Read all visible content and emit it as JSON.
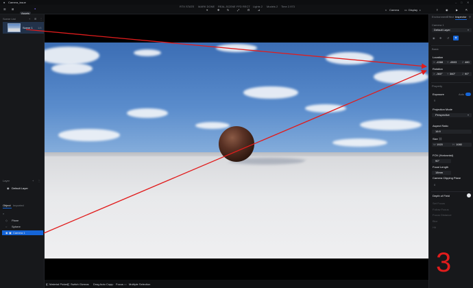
{
  "window": {
    "title": "Camera_issue"
  },
  "toolbar": {
    "assets_label": "Assets",
    "menu_items": [
      "RTX STATE",
      "MARK DONE",
      "REAL-SCENE",
      "FFD RECT",
      "Lights 2",
      "Models 2",
      "Time 2.973"
    ],
    "camera_label": "Camera",
    "display_label": "Display"
  },
  "left": {
    "scene_list_label": "Scene List",
    "scene_name": "Scene 1",
    "scene_count": "1/4",
    "layer_label": "Layer",
    "default_layer": "Default Layer",
    "object_tab": "Object",
    "imported_tab": "Imported",
    "objects": [
      "Plane",
      "Sphere",
      "Camera 1"
    ]
  },
  "right": {
    "tabs": [
      "Environment",
      "Effect",
      "Inspector"
    ],
    "camera_label": "Camera 1",
    "layer_value": "Default Layer",
    "basic_label": "Basic",
    "location_label": "Location",
    "location": {
      "x": "-4388",
      "y": "-6503",
      "z": "480"
    },
    "rotation_label": "Rotation",
    "rotation": {
      "x": "-360°",
      "y": "360°",
      "z": "90°"
    },
    "property_label": "Property",
    "exposure_label": "Exposure",
    "exposure_auto": "Auto",
    "exposure_value": "0",
    "projection_label": "Projection Mode",
    "projection_value": "Perspective",
    "aspect_label": "Aspect Ratio",
    "aspect_value": "16:9",
    "size_label": "Size",
    "size_w": "1920",
    "size_h": "1080",
    "fov_label": "FOV (Horizontal)",
    "fov_value": "90°",
    "focal_label": "Focal Length",
    "focal_value": "18mm",
    "clip_label": "Camera Clipping Plane",
    "clip_value": "0",
    "dof_label": "Depth of Field",
    "dof_items": [
      "Set Focus",
      "Follow Focus",
      "Focus Distance",
      "Blur",
      "Hit"
    ]
  },
  "status": {
    "items": [
      "Material Picker",
      "Switch Gizmos",
      "Drag Auto Copy",
      "Focus",
      "Multiple Selection"
    ]
  },
  "annotation": {
    "number": "3",
    "color": "#e11c1c"
  },
  "colors": {
    "accent": "#1565d8",
    "annotation": "#e11c1c"
  }
}
